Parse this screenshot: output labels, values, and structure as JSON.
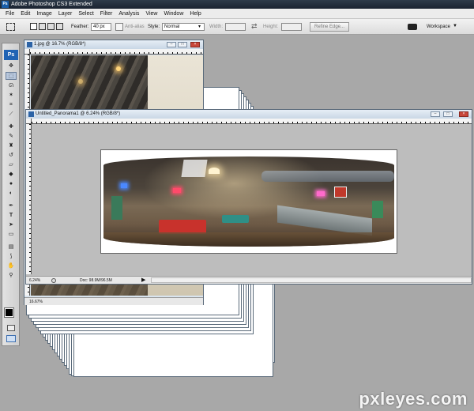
{
  "app": {
    "title": "Adobe Photoshop CS3 Extended",
    "ps_logo": "Ps"
  },
  "menu": [
    "File",
    "Edit",
    "Image",
    "Layer",
    "Select",
    "Filter",
    "Analysis",
    "View",
    "Window",
    "Help"
  ],
  "options": {
    "feather_label": "Feather:",
    "feather_value": "40 px",
    "antialias_label": "Anti-alias",
    "style_label": "Style:",
    "style_value": "Normal",
    "width_label": "Width:",
    "height_label": "Height:",
    "refine_edge": "Refine Edge...",
    "workspace": "Workspace"
  },
  "documents": {
    "back": {
      "title": "1.jpg @ 16.7% (RGB/8*)",
      "zoom": "16.67%"
    },
    "front": {
      "title": "Untitled_Panorama1 @ 6.24% (RGB/8*)",
      "zoom": "6.24%",
      "doc_info": "Doc: 98.9M/96.5M"
    }
  },
  "watermark": "pxleyes.com",
  "colors": {
    "title_bar": "#1f2a38",
    "ps_blue": "#1f63b4",
    "workspace_gray": "#a8a8a8"
  }
}
